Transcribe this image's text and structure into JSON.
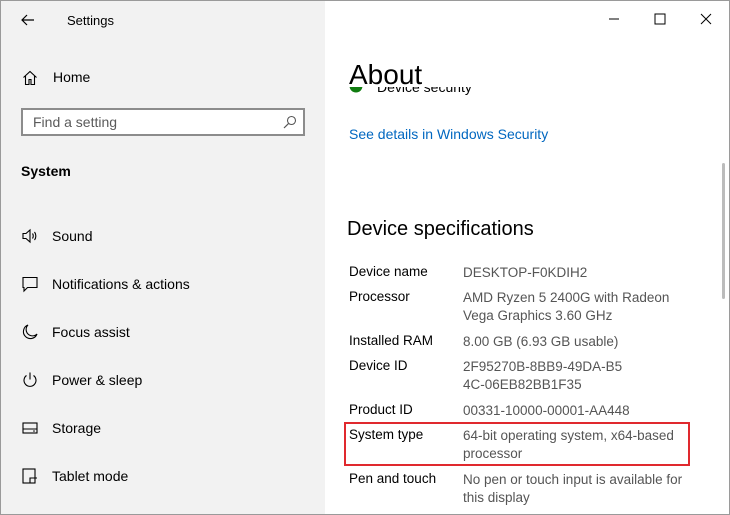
{
  "window": {
    "title": "Settings"
  },
  "sidebar": {
    "home_label": "Home",
    "search_placeholder": "Find a setting",
    "section": "System",
    "items": [
      {
        "label": "Sound",
        "icon": "speaker-icon"
      },
      {
        "label": "Notifications & actions",
        "icon": "message-icon"
      },
      {
        "label": "Focus assist",
        "icon": "moon-icon"
      },
      {
        "label": "Power & sleep",
        "icon": "power-icon"
      },
      {
        "label": "Storage",
        "icon": "storage-icon"
      },
      {
        "label": "Tablet mode",
        "icon": "tablet-icon"
      }
    ]
  },
  "main": {
    "title": "About",
    "defender_partial": "Device security",
    "link": "See details in Windows Security",
    "device_specs_title": "Device specifications",
    "specs": [
      {
        "label": "Device name",
        "value": "DESKTOP-F0KDIH2"
      },
      {
        "label": "Processor",
        "value": "AMD Ryzen 5 2400G with Radeon Vega Graphics         3.60 GHz"
      },
      {
        "label": "Installed RAM",
        "value": "8.00 GB (6.93 GB usable)"
      },
      {
        "label": "Device ID",
        "value": "2F95270B-8BB9-49DA-B54C-06EB82BB1F35"
      },
      {
        "label": "Product ID",
        "value": "00331-10000-00001-AA448"
      },
      {
        "label": "System type",
        "value": "64-bit operating system, x64-based processor"
      },
      {
        "label": "Pen and touch",
        "value": "No pen or touch input is available for this display"
      }
    ]
  },
  "colors": {
    "accent": "#0067c0",
    "highlight": "#e0292e",
    "sidebar_bg": "#f2f2f2"
  }
}
